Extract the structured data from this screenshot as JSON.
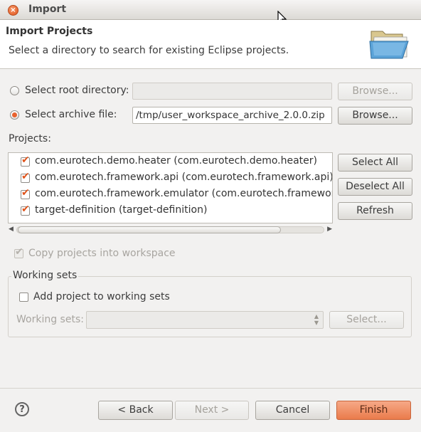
{
  "window": {
    "title": "Import",
    "close_symbol": "×"
  },
  "header": {
    "title": "Import Projects",
    "description": "Select a directory to search for existing Eclipse projects."
  },
  "source": {
    "root_dir": {
      "label": "Select root directory:",
      "selected": false,
      "value": "",
      "browse_label": "Browse...",
      "browse_enabled": false
    },
    "archive": {
      "label": "Select archive file:",
      "selected": true,
      "value": "/tmp/user_workspace_archive_2.0.0.zip",
      "browse_label": "Browse...",
      "browse_enabled": true
    }
  },
  "projects": {
    "label": "Projects:",
    "items": [
      {
        "label": "com.eurotech.demo.heater (com.eurotech.demo.heater)",
        "checked": true
      },
      {
        "label": "com.eurotech.framework.api (com.eurotech.framework.api)",
        "checked": true
      },
      {
        "label": "com.eurotech.framework.emulator (com.eurotech.framework.emulator)",
        "checked": true
      },
      {
        "label": "target-definition (target-definition)",
        "checked": true
      }
    ],
    "select_all_label": "Select All",
    "deselect_all_label": "Deselect All",
    "refresh_label": "Refresh"
  },
  "options": {
    "copy_label": "Copy projects into workspace",
    "copy_checked": true,
    "copy_enabled": false
  },
  "working_sets": {
    "group_label": "Working sets",
    "add_label": "Add project to working sets",
    "add_checked": false,
    "field_label": "Working sets:",
    "field_value": "",
    "select_label": "Select..."
  },
  "footer": {
    "help_symbol": "?",
    "back_label": "< Back",
    "next_label": "Next >",
    "cancel_label": "Cancel",
    "finish_label": "Finish"
  },
  "colors": {
    "accent": "#e8622e",
    "finish_button": "#ef8c60"
  }
}
